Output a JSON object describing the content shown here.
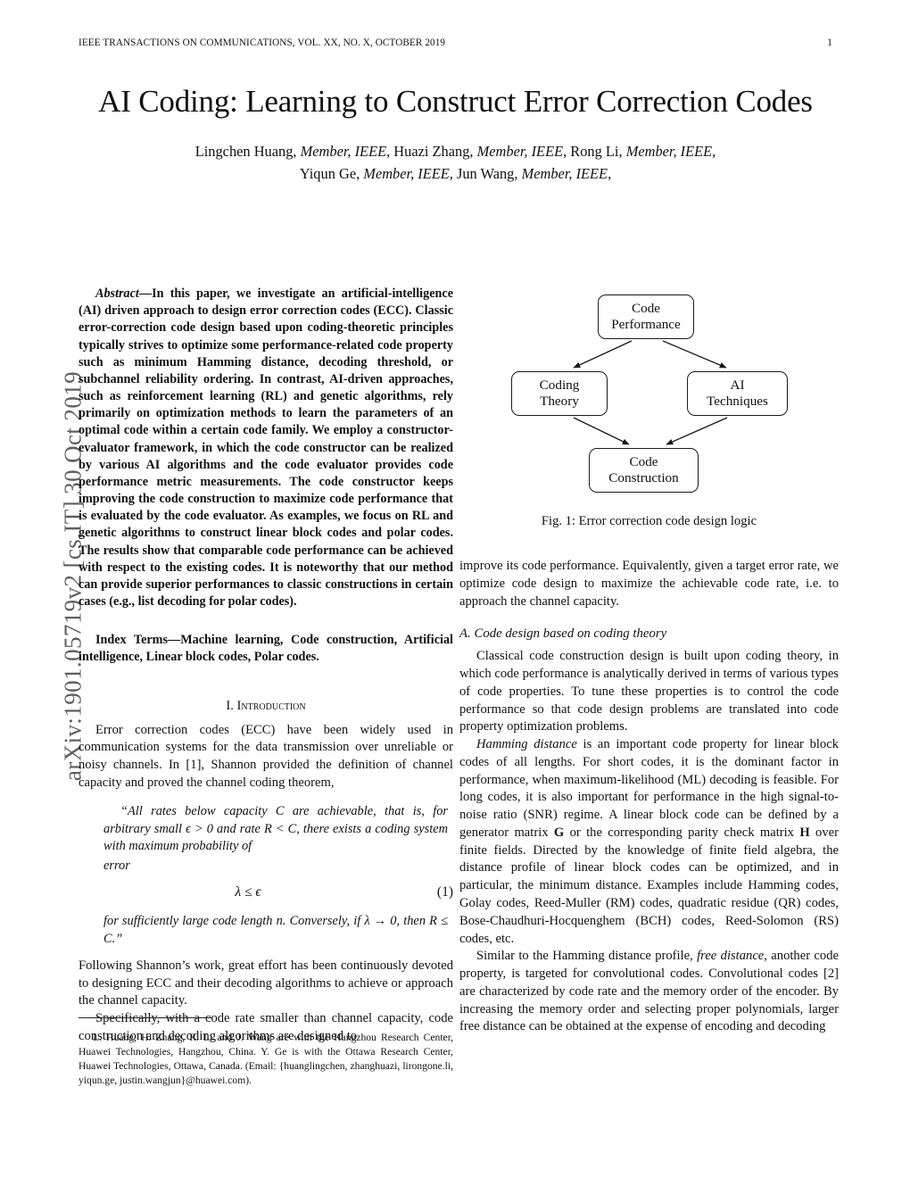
{
  "running_head": {
    "journal": "IEEE Transactions on Communications, Vol. XX, No. X, October 2019",
    "page_number": "1"
  },
  "title": "AI Coding: Learning to Construct Error Correction Codes",
  "authors": {
    "line1_a": "Lingchen Huang, ",
    "line1_m1": "Member, IEEE,",
    "line1_b": " Huazi Zhang, ",
    "line1_m2": "Member, IEEE,",
    "line1_c": " Rong Li, ",
    "line1_m3": "Member, IEEE,",
    "line2_a": "Yiqun Ge, ",
    "line2_m1": "Member, IEEE,",
    "line2_b": " Jun Wang, ",
    "line2_m2": "Member, IEEE,"
  },
  "arxiv_stamp": "arXiv:1901.05719v2  [cs.IT]  30 Oct 2019",
  "abstract": {
    "label": "Abstract",
    "dash": "—",
    "text": "In this paper, we investigate an artificial-intelligence (AI) driven approach to design error correction codes (ECC). Classic error-correction code design based upon coding-theoretic principles typically strives to optimize some performance-related code property such as minimum Hamming distance, decoding threshold, or subchannel reliability ordering. In contrast, AI-driven approaches, such as reinforcement learning (RL) and genetic algorithms, rely primarily on optimization methods to learn the parameters of an optimal code within a certain code family. We employ a constructor-evaluator framework, in which the code constructor can be realized by various AI algorithms and the code evaluator provides code performance metric measurements. The code constructor keeps improving the code construction to maximize code performance that is evaluated by the code evaluator. As examples, we focus on RL and genetic algorithms to construct linear block codes and polar codes. The results show that comparable code performance can be achieved with respect to the existing codes. It is noteworthy that our method can provide superior performances to classic constructions in certain cases (e.g., list decoding for polar codes)."
  },
  "index_terms": {
    "label": "Index Terms",
    "dash": "—",
    "text": "Machine learning, Code construction, Artificial intelligence, Linear block codes, Polar codes."
  },
  "sections": {
    "intro": {
      "numeral": "I.",
      "title": "Introduction",
      "p1": "Error correction codes (ECC) have been widely used in communication systems for the data transmission over unreliable or noisy channels. In [1], Shannon provided the definition of channel capacity and proved the channel coding theorem,",
      "quote_l1": "“All rates below capacity C are achievable, that is, for arbitrary small ϵ > 0 and rate R < C, there exists a coding system with maximum probability of",
      "quote_l2": "error",
      "equation": "λ ≤ ϵ",
      "equation_number": "(1)",
      "quote_l3": "for sufficiently large code length n. Conversely, if λ → 0, then R ≤ C.”",
      "p2": "Following Shannon’s work, great effort has been continuously devoted to designing ECC and their decoding algorithms to achieve or approach the channel capacity.",
      "p3": "Specifically, with a code rate smaller than channel capacity, code construction and decoding algorithms are designed to",
      "p4": "improve its code performance. Equivalently, given a target error rate, we optimize code design to maximize the achievable code rate, i.e. to approach the channel capacity."
    },
    "subsection_a": {
      "label": "A.",
      "title": "Code design based on coding theory",
      "p1": "Classical code construction design is built upon coding theory, in which code performance is analytically derived in terms of various types of code properties. To tune these properties is to control the code performance so that code design problems are translated into code property optimization problems.",
      "p2_lead": "Hamming distance",
      "p2_rest": " is an important code property for linear block codes of all lengths. For short codes, it is the dominant factor in performance, when maximum-likelihood (ML) decoding is feasible. For long codes, it is also important for performance in the high signal-to-noise ratio (SNR) regime. A linear block code can be defined by a generator matrix ",
      "p2_g": "G",
      "p2_mid": " or the corresponding parity check matrix ",
      "p2_h": "H",
      "p2_tail": " over finite fields. Directed by the knowledge of finite field algebra, the distance profile of linear block codes can be optimized, and in particular, the minimum distance. Examples include Hamming codes, Golay codes, Reed-Muller (RM) codes, quadratic residue (QR) codes, Bose-Chaudhuri-Hocquenghem (BCH) codes, Reed-Solomon (RS) codes, etc.",
      "p3_pre": "Similar to the Hamming distance profile, ",
      "p3_it": "free distance",
      "p3_post": ", another code property, is targeted for convolutional codes. Convolutional codes [2] are characterized by code rate and the memory order of the encoder. By increasing the memory order and selecting proper polynomials, larger free distance can be obtained at the expense of encoding and decoding"
    }
  },
  "figure": {
    "caption": "Fig. 1: Error correction code design logic",
    "nodes": [
      {
        "id": "code-performance",
        "line1": "Code",
        "line2": "Performance"
      },
      {
        "id": "coding-theory",
        "line1": "Coding",
        "line2": "Theory"
      },
      {
        "id": "ai-techniques",
        "line1": "AI",
        "line2": "Techniques"
      },
      {
        "id": "code-construction",
        "line1": "Code",
        "line2": "Construction"
      }
    ]
  },
  "footnote": "L. Huang, H. Zhang, R. Li and J. Wang are with the Hangzhou Research Center, Huawei Technologies, Hangzhou, China. Y. Ge is with the Ottawa Research Center, Huawei Technologies, Ottawa, Canada. (Email: {huanglingchen, zhanghuazi, lirongone.li, yiqun.ge, justin.wangjun}@huawei.com)."
}
